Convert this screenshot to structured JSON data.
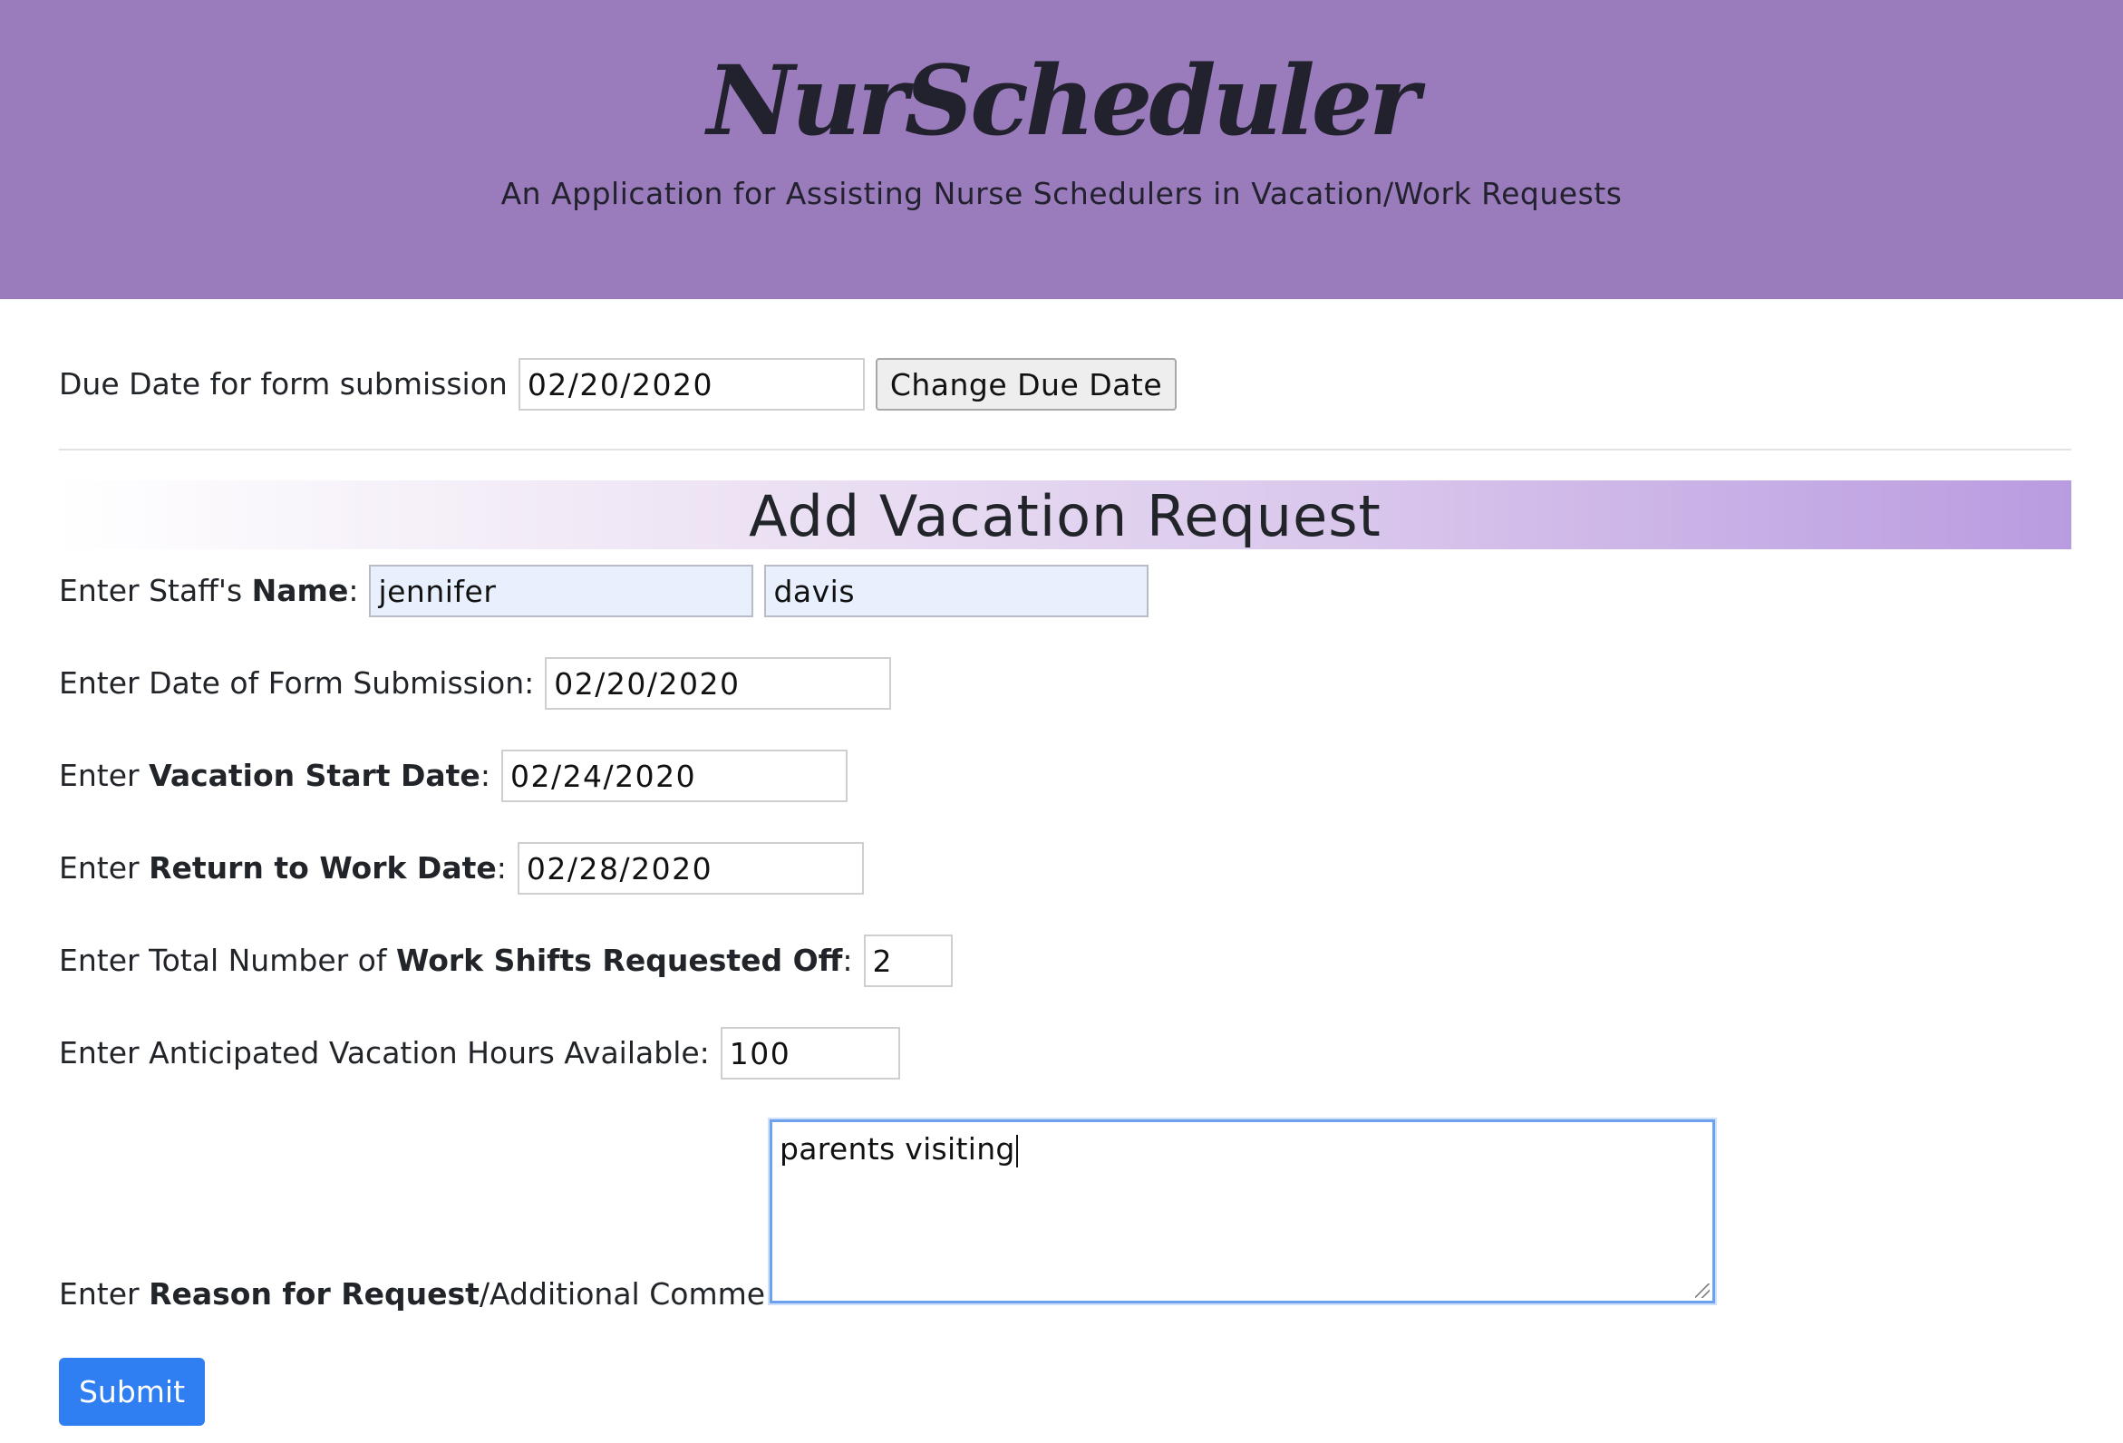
{
  "header": {
    "app_title": "NurScheduler",
    "subtitle": "An Application for Assisting Nurse Schedulers in Vacation/Work Requests"
  },
  "due_date": {
    "label": "Due Date for form submission",
    "value": "02/20/2020",
    "button_label": "Change Due Date"
  },
  "section": {
    "title": "Add Vacation Request"
  },
  "form": {
    "name": {
      "label_prefix": "Enter Staff's ",
      "label_bold": "Name",
      "label_suffix": ":",
      "first_name": "jennifer",
      "last_name": "davis"
    },
    "submission_date": {
      "label": "Enter Date of Form Submission:",
      "value": "02/20/2020"
    },
    "vacation_start": {
      "label_prefix": "Enter ",
      "label_bold": "Vacation Start Date",
      "label_suffix": ":",
      "value": "02/24/2020"
    },
    "return_date": {
      "label_prefix": "Enter ",
      "label_bold": "Return to Work Date",
      "label_suffix": ":",
      "value": "02/28/2020"
    },
    "shifts_off": {
      "label_prefix": "Enter Total Number of ",
      "label_bold": "Work Shifts Requested Off",
      "label_suffix": ":",
      "value": "2"
    },
    "vacation_hours": {
      "label": "Enter Anticipated Vacation Hours Available:",
      "value": "100"
    },
    "comments": {
      "label_prefix": "Enter ",
      "label_bold": "Reason for Request",
      "label_suffix": "/Additional Comments:",
      "value": "parents visiting"
    },
    "submit_label": "Submit"
  },
  "colors": {
    "header_bg": "#9a7bbb",
    "banner_end": "#b99be0",
    "submit_bg": "#2f7ef2",
    "focus_border": "#6da1ee",
    "autofill_bg": "#e8f0fe"
  }
}
